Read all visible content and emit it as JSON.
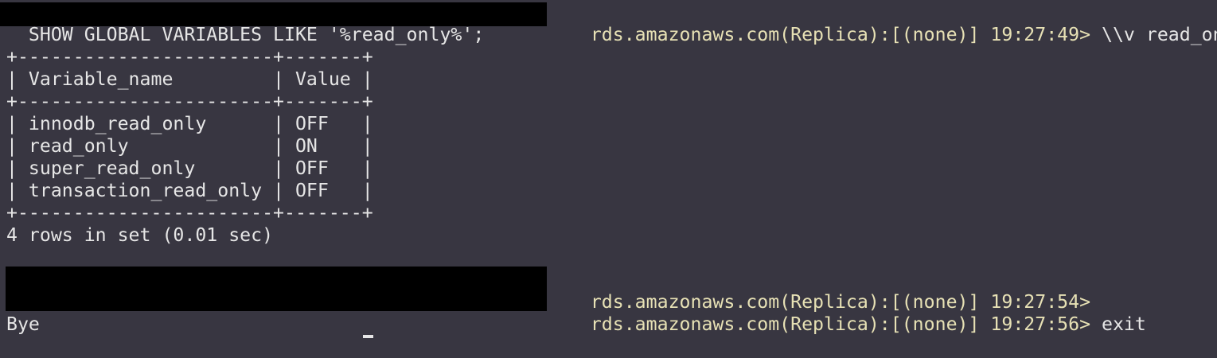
{
  "terminal": {
    "lines": [
      {
        "prompt": "rds.amazonaws.com(Replica):[(none)] 19:27:49> ",
        "command": "\\\\v read_only"
      },
      {
        "text": "  SHOW GLOBAL VARIABLES LIKE '%read_only%';"
      },
      {
        "text": "+-----------------------+-------+"
      },
      {
        "text": "| Variable_name         | Value |"
      },
      {
        "text": "+-----------------------+-------+"
      },
      {
        "text": "| innodb_read_only      | OFF   |"
      },
      {
        "text": "| read_only             | ON    |"
      },
      {
        "text": "| super_read_only       | OFF   |"
      },
      {
        "text": "| transaction_read_only | OFF   |"
      },
      {
        "text": "+-----------------------+-------+"
      },
      {
        "text": "4 rows in set (0.01 sec)"
      },
      {
        "text": ""
      },
      {
        "prompt": "rds.amazonaws.com(Replica):[(none)] 19:27:54>",
        "command": ""
      },
      {
        "prompt": "rds.amazonaws.com(Replica):[(none)] 19:27:56> ",
        "command": "exit"
      },
      {
        "text": "Bye"
      }
    ]
  },
  "colors": {
    "background": "#383641",
    "prompt": "#e7e1b5",
    "text": "#e6e6e6",
    "redaction": "#000000"
  }
}
